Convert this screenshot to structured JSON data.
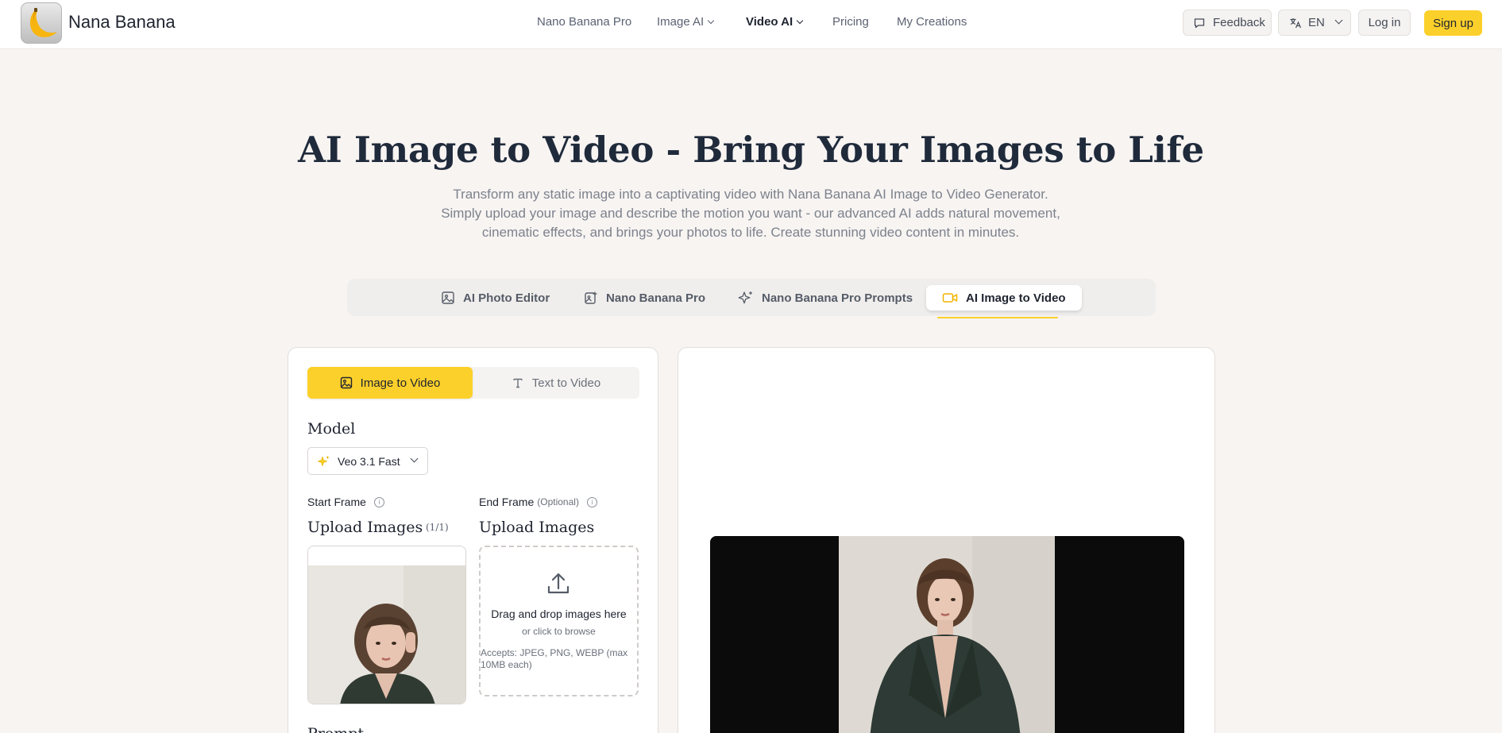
{
  "header": {
    "brand": "Nana Banana",
    "nav": [
      {
        "label": "Nano Banana Pro"
      },
      {
        "label": "Image AI"
      },
      {
        "label": "Video AI"
      },
      {
        "label": "Pricing"
      },
      {
        "label": "My Creations"
      }
    ],
    "feedback": "Feedback",
    "language": "EN",
    "login": "Log in",
    "signup": "Sign up"
  },
  "hero": {
    "title": "AI Image to Video - Bring Your Images to Life",
    "subtitle": "Transform any static image into a captivating video with Nana Banana AI Image to Video Generator. Simply upload your image and describe the motion you want - our advanced AI adds natural movement, cinematic effects, and brings your photos to life. Create stunning video content in minutes."
  },
  "tool_tabs": [
    {
      "label": "AI Photo Editor"
    },
    {
      "label": "Nano Banana Pro"
    },
    {
      "label": "Nano Banana Pro Prompts"
    },
    {
      "label": "AI Image to Video"
    }
  ],
  "form": {
    "modes": [
      {
        "label": "Image to Video"
      },
      {
        "label": "Text to Video"
      }
    ],
    "model_heading": "Model",
    "model_value": "Veo 3.1 Fast",
    "start_frame": {
      "label": "Start Frame",
      "heading": "Upload Images",
      "count": "(1/1)"
    },
    "end_frame": {
      "label": "End Frame",
      "optional": "(Optional)",
      "heading": "Upload Images"
    },
    "dropzone": {
      "main": "Drag and drop images here",
      "sub": "or click to browse",
      "accepts": "Accepts: JPEG, PNG, WEBP (max 10MB each)"
    },
    "prompt_heading": "Prompt"
  },
  "colors": {
    "accent": "#fcd02a",
    "background": "#f7f4f2",
    "text": "#1f2430"
  }
}
